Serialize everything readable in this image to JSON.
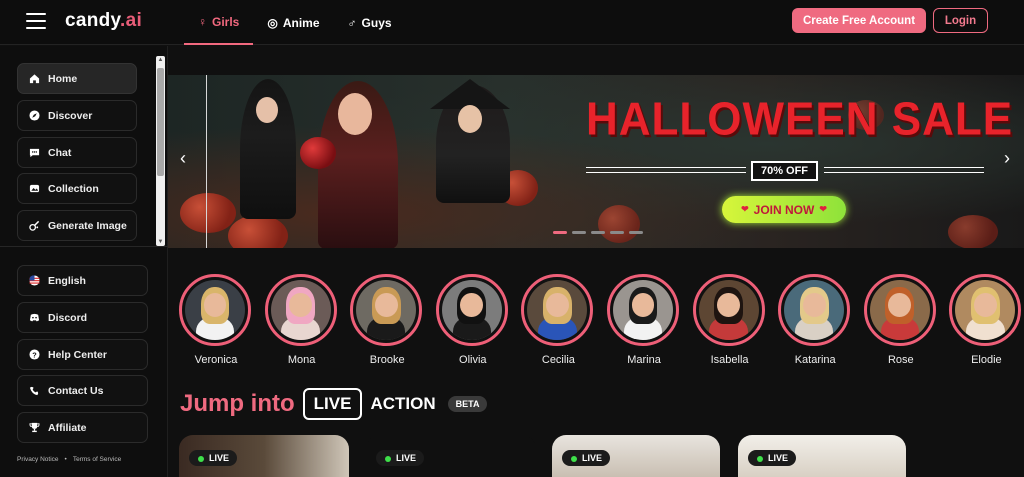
{
  "brand": {
    "name": "candy",
    "suffix": ".ai"
  },
  "nav": {
    "tabs": [
      {
        "label": "Girls",
        "icon": "female-icon",
        "active": true
      },
      {
        "label": "Anime",
        "icon": "anime-icon",
        "active": false
      },
      {
        "label": "Guys",
        "icon": "male-icon",
        "active": false
      }
    ],
    "create_account": "Create Free Account",
    "login": "Login"
  },
  "sidebar": {
    "main": [
      {
        "label": "Home",
        "icon": "home-icon",
        "active": true
      },
      {
        "label": "Discover",
        "icon": "compass-icon"
      },
      {
        "label": "Chat",
        "icon": "chat-icon"
      },
      {
        "label": "Collection",
        "icon": "collection-icon"
      },
      {
        "label": "Generate Image",
        "icon": "generate-image-icon"
      }
    ],
    "secondary": [
      {
        "label": "English",
        "icon": "us-flag-icon"
      },
      {
        "label": "Discord",
        "icon": "discord-icon"
      },
      {
        "label": "Help Center",
        "icon": "help-icon"
      },
      {
        "label": "Contact Us",
        "icon": "contact-icon"
      },
      {
        "label": "Affiliate",
        "icon": "trophy-icon"
      }
    ],
    "footer": {
      "privacy": "Privacy Notice",
      "separator": "•",
      "terms": "Terms of Service"
    }
  },
  "banner": {
    "title": "HALLOWEEN SALE",
    "discount": "70% OFF",
    "cta": "JOIN NOW",
    "slides": 5,
    "active_slide": 1
  },
  "characters": [
    {
      "name": "Veronica",
      "hair": "#d9b56a",
      "top": "#f2f2f2",
      "bg": "#3a3f46"
    },
    {
      "name": "Mona",
      "hair": "#f0a7c2",
      "top": "#e8d6d0",
      "bg": "#6b5b57"
    },
    {
      "name": "Brooke",
      "hair": "#c99a55",
      "top": "#1a1a1a",
      "bg": "#6e6a62"
    },
    {
      "name": "Olivia",
      "hair": "#111111",
      "top": "#1a1a1a",
      "bg": "#7c7c7c"
    },
    {
      "name": "Cecilia",
      "hair": "#d8b26a",
      "top": "#2a55b8",
      "bg": "#5a4a3c"
    },
    {
      "name": "Marina",
      "hair": "#1a1a1a",
      "top": "#f2f2f2",
      "bg": "#9a9590"
    },
    {
      "name": "Isabella",
      "hair": "#1e1410",
      "top": "#c43a3a",
      "bg": "#5d4633"
    },
    {
      "name": "Katarina",
      "hair": "#e3c98a",
      "top": "#d9d0c5",
      "bg": "#4a6a7a"
    },
    {
      "name": "Rose",
      "hair": "#c0602a",
      "top": "#c93a3a",
      "bg": "#8a6a4a"
    },
    {
      "name": "Elodie",
      "hair": "#e0c070",
      "top": "#f0e0d0",
      "bg": "#b08a60"
    }
  ],
  "live_section": {
    "title": "Jump into",
    "live": "LIVE",
    "action": "ACTION",
    "beta": "BETA"
  },
  "live_cards": [
    {
      "tag": "LIVE"
    },
    {
      "tag": "LIVE"
    },
    {
      "tag": "LIVE"
    },
    {
      "tag": "LIVE"
    }
  ],
  "colors": {
    "accent": "#ef6a80",
    "sale_red": "#e8232b",
    "join_green": "#b6ec3a"
  }
}
